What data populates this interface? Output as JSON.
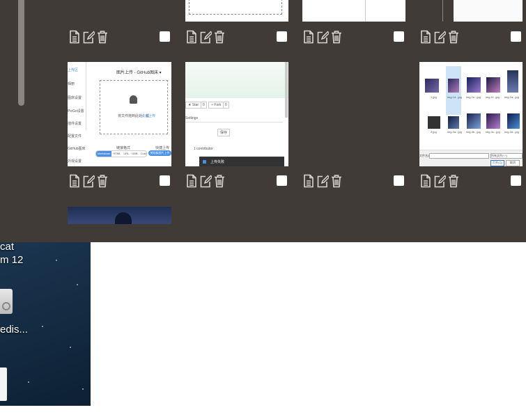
{
  "panel": {
    "action_labels": [
      "Details",
      "Edit",
      "Delete"
    ],
    "icons": {
      "details": "document-icon",
      "edit": "edit-icon",
      "delete": "trash-icon"
    }
  },
  "thumb_upload": {
    "nav": [
      "上传区",
      "相册",
      "图床设置",
      "PicGo设置",
      "插件设置",
      "配置文件",
      "GitHub图床",
      "外观设置"
    ],
    "title": "图片上传 - GitHub图床 ▾",
    "hint": "将文件拖到此处，或",
    "hint_link": "点击上传",
    "left_label": "链接格式",
    "right_label": "快捷上传",
    "formats": [
      "Markdown",
      "HTML",
      "URL",
      "UBB",
      "Custom"
    ],
    "clip_button": "剪贴板图片上传"
  },
  "thumb_github": {
    "star": "★ Star",
    "star_count": "0",
    "fork": "⑂ Fork",
    "fork_count": "0",
    "settings": "Settings",
    "save": "保存",
    "contributors": "1 contributor",
    "toast": "上传失败"
  },
  "thumb_filedialog": {
    "filename_label": "文件名(N):",
    "filter": "所有文件(*.*)",
    "open": "打开(O)",
    "cancel": "取消",
    "files": [
      "1.jpg",
      "img-1d...jpg",
      "img-1e...jpg",
      "img-1f...jpg",
      "img-2a...jpg",
      "2.jpg",
      "img-3a...jpg",
      "img-3b...jpg",
      "img-3c...jpg",
      "img-3d...jpg"
    ]
  },
  "desktop": {
    "labels": [
      "cat",
      "m 12",
      "edis..."
    ]
  }
}
